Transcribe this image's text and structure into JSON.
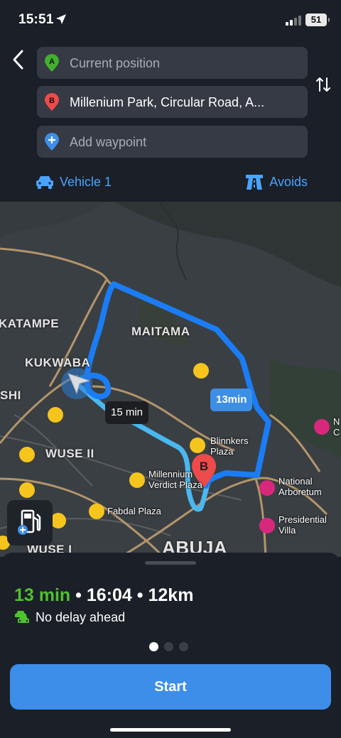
{
  "status": {
    "time": "15:51",
    "battery": "51",
    "icons": [
      "location-arrow-icon",
      "signal-icon"
    ]
  },
  "route_form": {
    "start_pin_letter": "A",
    "start_placeholder": "Current position",
    "destination_pin_letter": "B",
    "destination_value": "Millenium Park, Circular Road, A...",
    "waypoint_placeholder": "Add waypoint",
    "vehicle_label": "Vehicle 1",
    "avoids_label": "Avoids"
  },
  "map": {
    "areas": [
      "KATAMPE",
      "MAITAMA",
      "KUKWABA",
      "SHI",
      "WUSE II",
      "WUSE I",
      "ABUJA"
    ],
    "pois": {
      "blinnkers": "Blinnkers\nPlaza",
      "millennium": "Millennium\nVerdict Plaza",
      "fabdal": "Fabdal Plaza",
      "national": "National\nArboretum",
      "presidential": "Presidential\nVilla",
      "edge_label": "N\nC"
    },
    "route_alt_time": "15 min",
    "route_main_time": "13min",
    "destination_marker": "B",
    "colors": {
      "route": "#1a7df5",
      "route_alt": "#4ab8f0",
      "road": "#b3956a",
      "poi": "#f5c51e",
      "poi_pink": "#d8287b"
    }
  },
  "sheet": {
    "duration": "13 min",
    "separator": "•",
    "arrival": "16:04",
    "distance": "12km",
    "delay_text": "No delay ahead",
    "start_label": "Start",
    "pages": 3,
    "active_page": 0
  }
}
